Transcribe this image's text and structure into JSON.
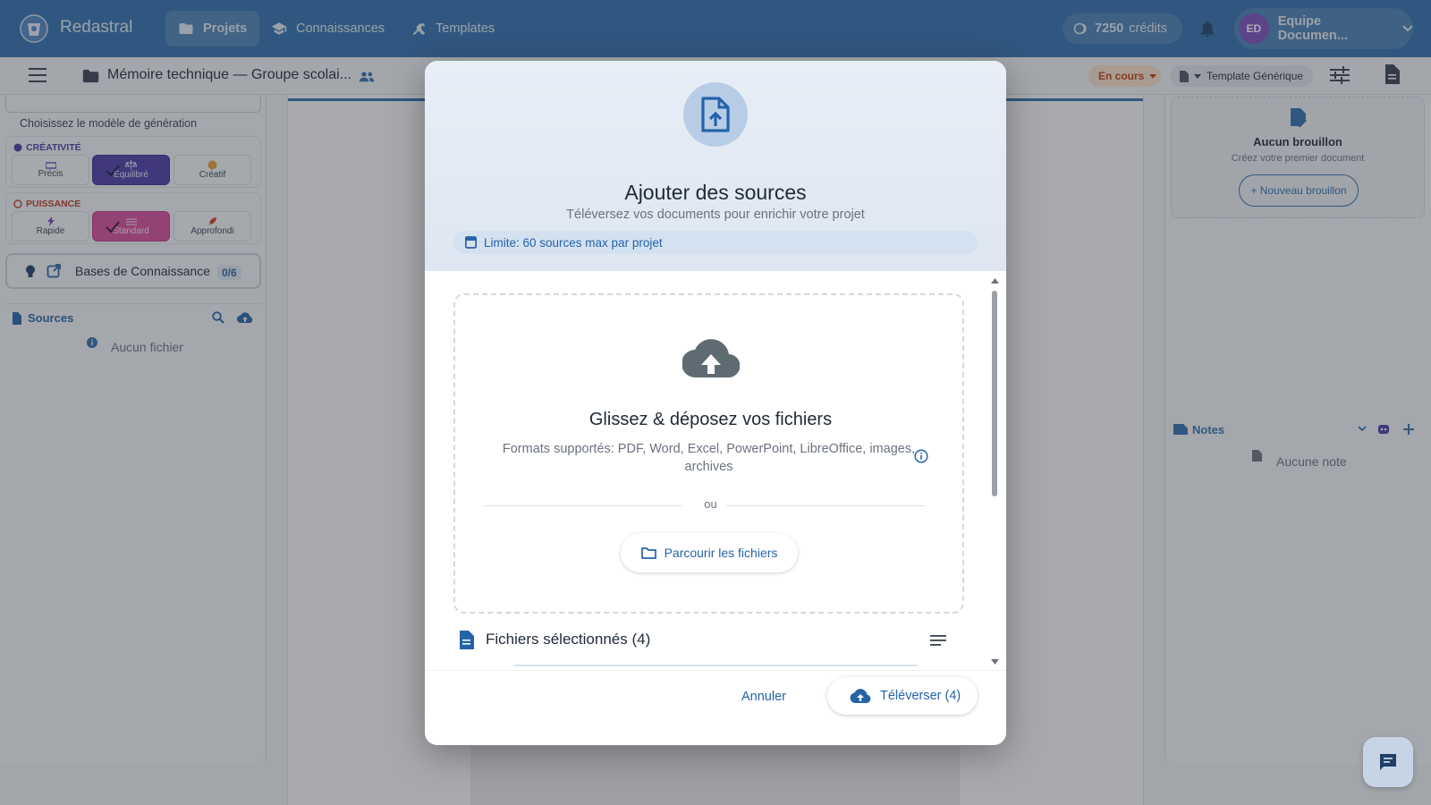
{
  "app": {
    "brand": "Redastral"
  },
  "nav": {
    "items": [
      {
        "label": "Projets",
        "icon": "folder-icon",
        "active": true
      },
      {
        "label": "Connaissances",
        "icon": "school-icon",
        "active": false
      },
      {
        "label": "Templates",
        "icon": "tools-icon",
        "active": false
      }
    ]
  },
  "credits": {
    "amount": "7250",
    "label": "crédits"
  },
  "account": {
    "initials": "ED",
    "name": "Equipe Documen..."
  },
  "subbar": {
    "doc_title": "Mémoire technique — Groupe scolai...",
    "status": "En cours",
    "template": "Template Générique"
  },
  "left": {
    "model_hint": "Choisissez le modèle de génération",
    "creativity": {
      "title": "CRÉATIVITÉ",
      "options": [
        "Précis",
        "Équilibré",
        "Créatif"
      ],
      "selected": "Équilibré"
    },
    "power": {
      "title": "PUISSANCE",
      "options": [
        "Rapide",
        "Standard",
        "Approfondi"
      ],
      "selected": "Standard"
    },
    "knowledge": {
      "label": "Bases de Connaissance",
      "count": "0/6"
    },
    "sources": {
      "label": "Sources",
      "empty": "Aucun fichier"
    }
  },
  "right": {
    "draft": {
      "title": "Aucun brouillon",
      "subtitle": "Créez votre premier document",
      "button": "+ Nouveau brouillon"
    },
    "notes": {
      "label": "Notes",
      "empty": "Aucune note"
    }
  },
  "modal": {
    "title": "Ajouter des sources",
    "subtitle": "Téléversez vos documents pour enrichir votre projet",
    "limit": "Limite: 60 sources max par projet",
    "dropzone": {
      "title": "Glissez & déposez vos fichiers",
      "formats": "Formats supportés: PDF, Word, Excel, PowerPoint, LibreOffice, images, archives",
      "or": "ou",
      "browse": "Parcourir les fichiers"
    },
    "selected": {
      "title": "Fichiers sélectionnés (4)"
    },
    "footer": {
      "cancel": "Annuler",
      "upload": "Téléverser (4)"
    }
  },
  "colors": {
    "topbar": "#2f6fae",
    "accent": "#2563a8",
    "creativity_selected": "#4b3aa8",
    "power_selected": "#d94b9a",
    "status_pill": "#fde6cf"
  }
}
